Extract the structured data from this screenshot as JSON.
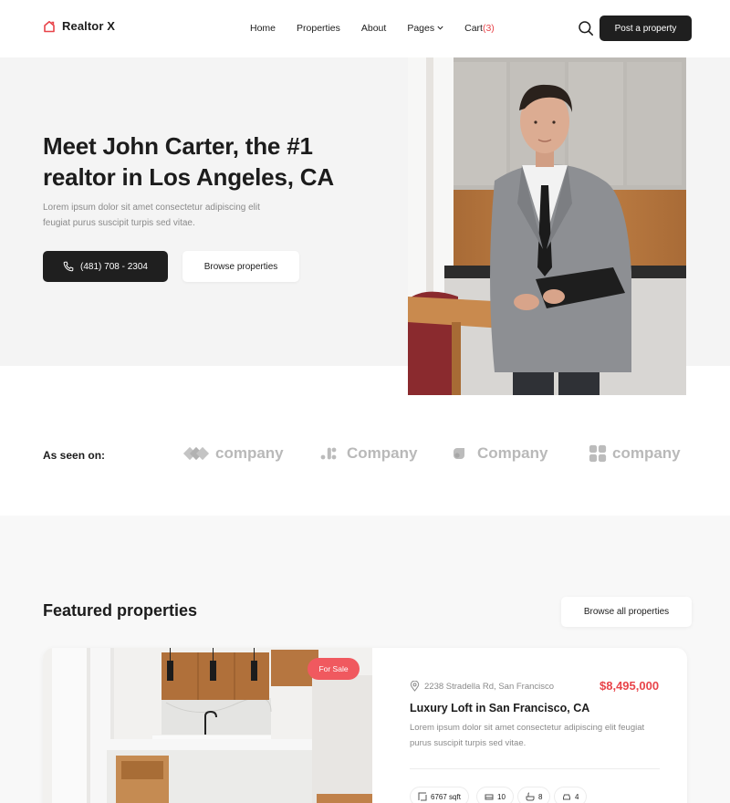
{
  "header": {
    "logo": "Realtor X",
    "nav": [
      {
        "label": "Home"
      },
      {
        "label": "Properties"
      },
      {
        "label": "About"
      },
      {
        "label": "Pages",
        "dropdown": true
      },
      {
        "label": "Cart",
        "count": "(3)"
      }
    ],
    "cta": "Post a property"
  },
  "hero": {
    "title": "Meet John Carter, the #1 realtor in Los Angeles, CA",
    "description": "Lorem ipsum dolor sit amet consectetur adipiscing elit feugiat purus suscipit turpis sed vitae.",
    "phone": "(481) 708 - 2304",
    "browse": "Browse properties"
  },
  "seen_on": {
    "label": "As seen on:",
    "brands": [
      "company",
      "Company",
      "Company",
      "company"
    ]
  },
  "featured": {
    "title": "Featured properties",
    "browse_all": "Browse all properties",
    "card": {
      "badge": "For Sale",
      "address": "2238 Stradella Rd, San Francisco",
      "price": "$8,495,000",
      "title": "Luxury Loft in San Francisco, CA",
      "description": "Lorem ipsum dolor sit amet consectetur adipiscing elit feugiat purus suscipit turpis sed vitae.",
      "features": {
        "area": "6767 sqft",
        "beds": "10",
        "baths": "8",
        "garage": "4"
      }
    }
  },
  "colors": {
    "accent": "#e8444a",
    "dark": "#1f1f1f",
    "badge": "#f0595f"
  }
}
